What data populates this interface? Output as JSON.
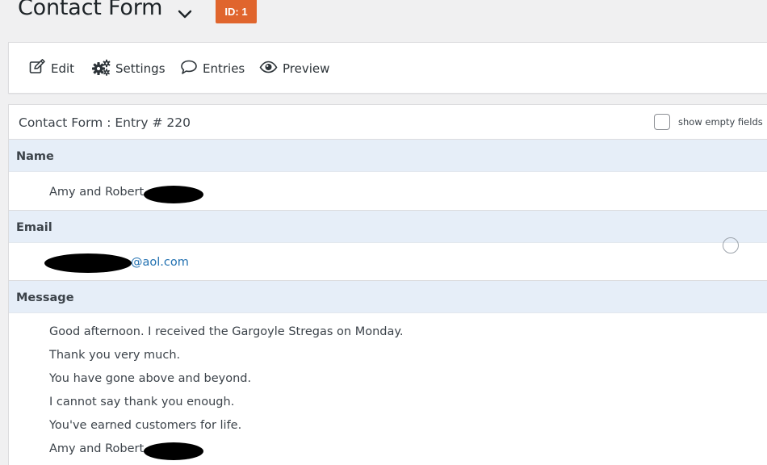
{
  "header": {
    "form_title": "Contact Form",
    "id_badge": "ID: 1"
  },
  "toolbar": {
    "items": [
      {
        "label": "Edit",
        "icon": "edit-icon"
      },
      {
        "label": "Settings",
        "icon": "gears-icon"
      },
      {
        "label": "Entries",
        "icon": "speech-bubble-icon"
      },
      {
        "label": "Preview",
        "icon": "eye-icon"
      }
    ]
  },
  "entry": {
    "title": "Contact Form : Entry # 220",
    "show_empty_label": "show empty fields",
    "fields": {
      "name": {
        "label": "Name",
        "value": "Amy and Robert"
      },
      "email": {
        "label": "Email",
        "value": "@aol.com"
      },
      "message": {
        "label": "Message",
        "lines": [
          "Good afternoon. I received the Gargoyle Stregas on Monday.",
          "Thank you very much.",
          "You have gone above and beyond.",
          "I cannot say thank you enough.",
          "You've earned customers for life.",
          "Amy and Robert"
        ]
      }
    }
  },
  "colors": {
    "badge": "#e0652d",
    "field_label_bg": "#e6eef8",
    "link": "#2271b1",
    "page_bg": "#f0f0f1"
  }
}
